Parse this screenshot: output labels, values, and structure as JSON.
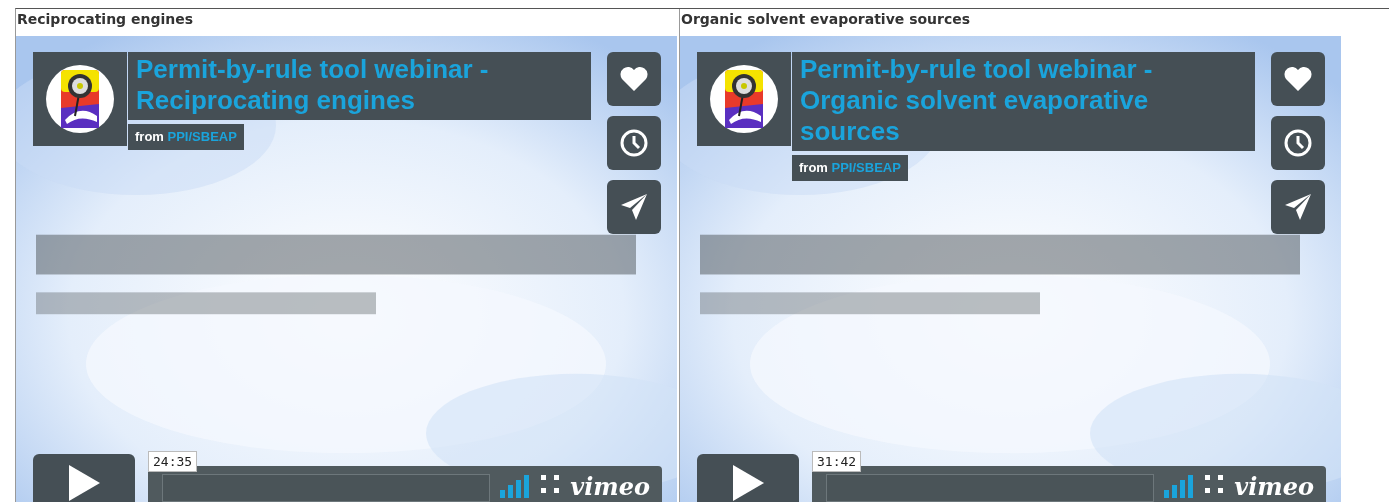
{
  "videos": [
    {
      "heading": "Reciprocating engines",
      "title": "Permit-by-rule tool webinar - Reciprocating engines",
      "from_label": "from",
      "owner": "PPI/SBEAP",
      "duration": "24:35",
      "logo": "vimeo"
    },
    {
      "heading": "Organic solvent evaporative sources",
      "title": "Permit-by-rule tool webinar - Organic solvent evaporative sources",
      "from_label": "from",
      "owner": "PPI/SBEAP",
      "duration": "31:42",
      "logo": "vimeo"
    }
  ]
}
